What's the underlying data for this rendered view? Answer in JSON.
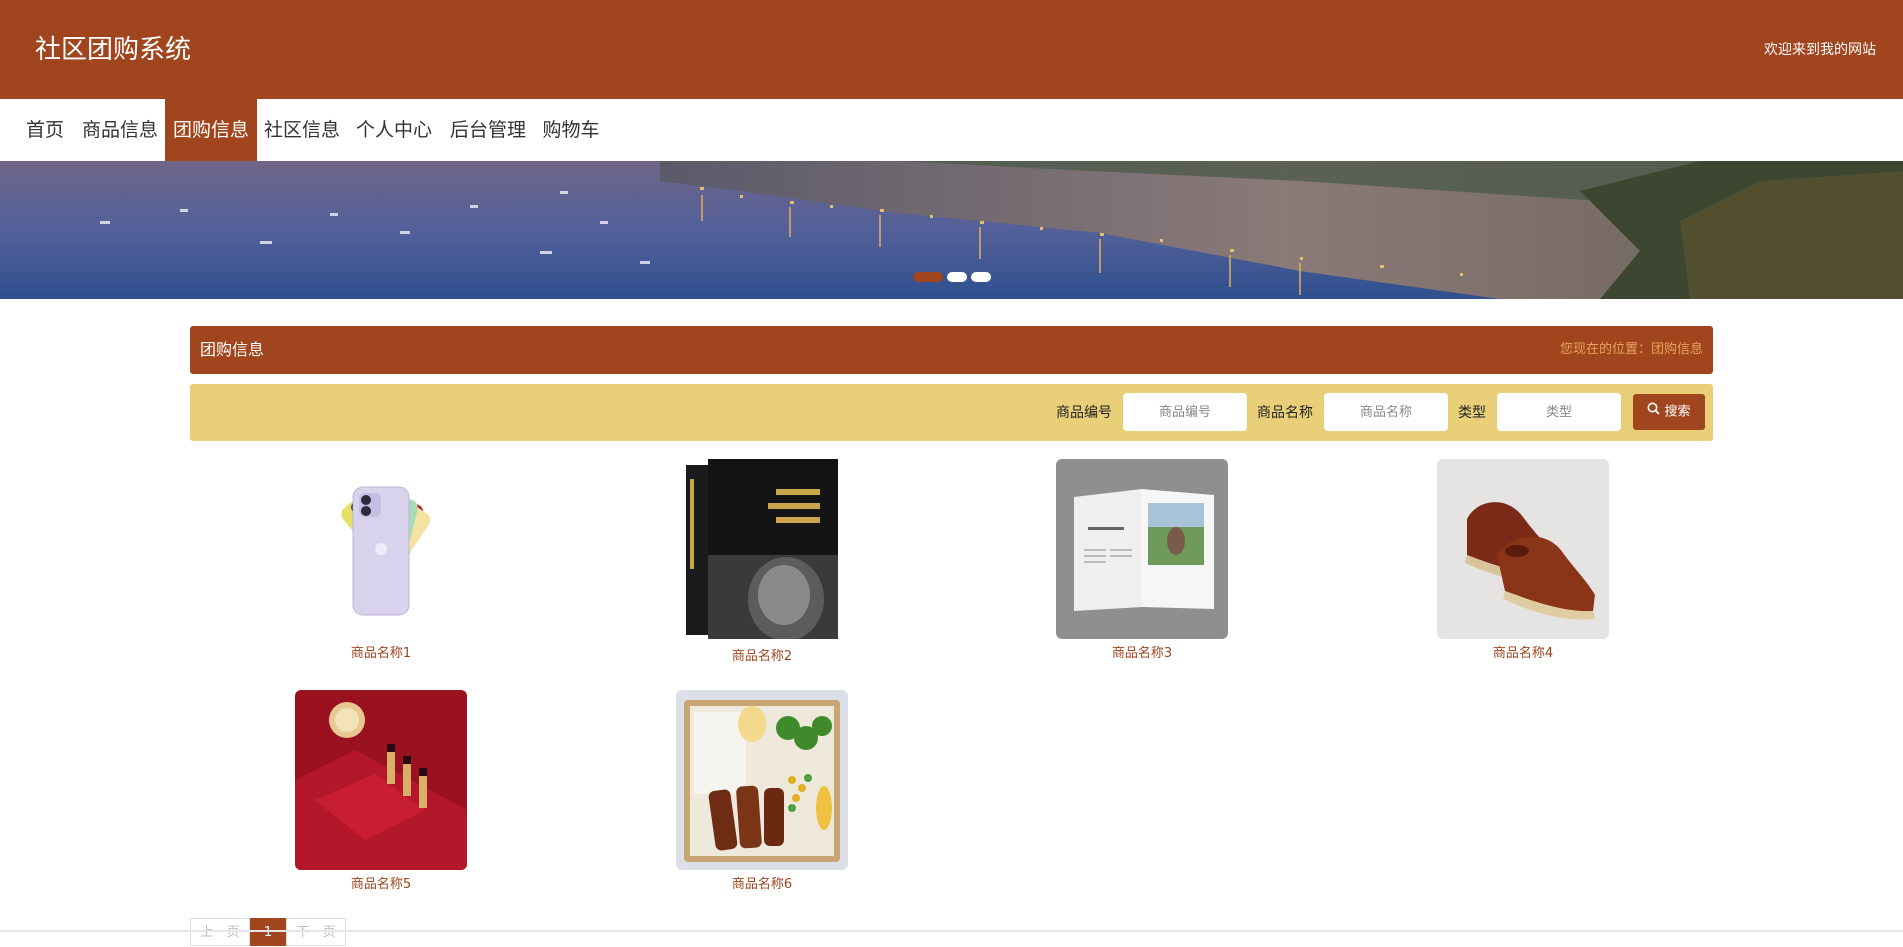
{
  "header": {
    "title": "社区团购系统",
    "welcome": "欢迎来到我的网站"
  },
  "nav": {
    "items": [
      {
        "label": "首页"
      },
      {
        "label": "商品信息"
      },
      {
        "label": "团购信息"
      },
      {
        "label": "社区信息"
      },
      {
        "label": "个人中心"
      },
      {
        "label": "后台管理"
      },
      {
        "label": "购物车"
      }
    ],
    "active_index": 2
  },
  "carousel": {
    "slide_count": 3,
    "active_index": 0
  },
  "section": {
    "title": "团购信息",
    "breadcrumb": "您现在的位置：团购信息"
  },
  "search": {
    "fields": [
      {
        "label": "商品编号",
        "placeholder": "商品编号",
        "value": ""
      },
      {
        "label": "商品名称",
        "placeholder": "商品名称",
        "value": ""
      },
      {
        "label": "类型",
        "placeholder": "类型",
        "value": ""
      }
    ],
    "button_label": "搜索",
    "button_icon": "search-icon"
  },
  "products": [
    {
      "name": "商品名称1",
      "image": "phone-image"
    },
    {
      "name": "商品名称2",
      "image": "book-image"
    },
    {
      "name": "商品名称3",
      "image": "magazine-image"
    },
    {
      "name": "商品名称4",
      "image": "shoes-image"
    },
    {
      "name": "商品名称5",
      "image": "gift-box-image"
    },
    {
      "name": "商品名称6",
      "image": "bento-image"
    }
  ],
  "pagination": {
    "prev_label": "上一页",
    "current_page": "1",
    "next_label": "下一页"
  },
  "colors": {
    "primary": "#a0451d",
    "search_bar": "#e8cf78",
    "breadcrumb": "#e8a45a"
  }
}
